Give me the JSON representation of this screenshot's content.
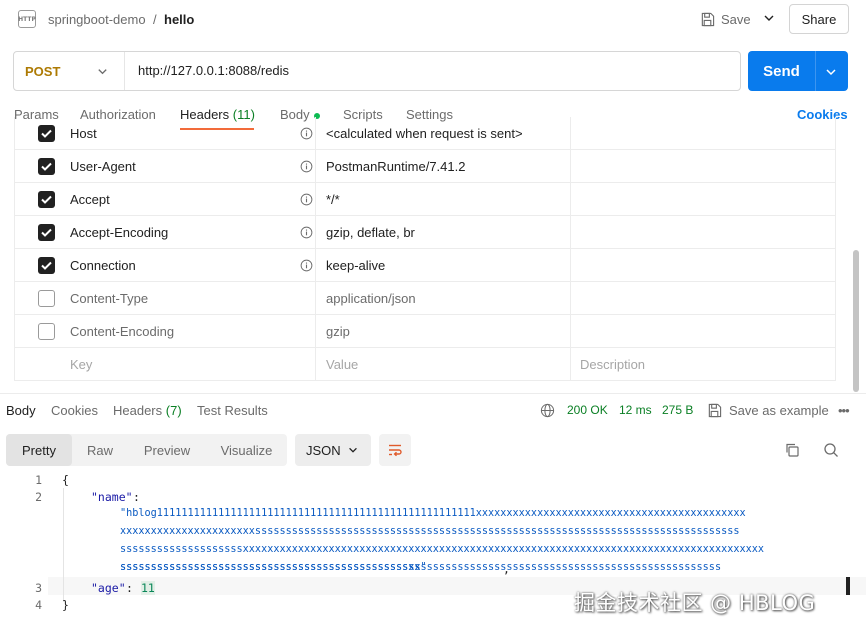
{
  "breadcrumb": {
    "collection": "springboot-demo",
    "separator": "/",
    "request": "hello"
  },
  "header": {
    "save_label": "Save",
    "share_label": "Share",
    "http_icon_text": "HTTP"
  },
  "request": {
    "method": "POST",
    "url": "http://127.0.0.1:8088/redis",
    "send_label": "Send"
  },
  "request_tabs": [
    {
      "label": "Params"
    },
    {
      "label": "Authorization"
    },
    {
      "label": "Headers",
      "count": "(11)"
    },
    {
      "label": "Body"
    },
    {
      "label": "Scripts"
    },
    {
      "label": "Settings"
    }
  ],
  "cookies_label": "Cookies",
  "headers_table": {
    "rows": [
      {
        "checked": true,
        "key": "Host",
        "value": "<calculated when request is sent>"
      },
      {
        "checked": true,
        "key": "User-Agent",
        "value": "PostmanRuntime/7.41.2"
      },
      {
        "checked": true,
        "key": "Accept",
        "value": "*/*"
      },
      {
        "checked": true,
        "key": "Accept-Encoding",
        "value": "gzip, deflate, br"
      },
      {
        "checked": true,
        "key": "Connection",
        "value": "keep-alive"
      },
      {
        "checked": false,
        "key": "Content-Type",
        "value": "application/json"
      },
      {
        "checked": false,
        "key": "Content-Encoding",
        "value": "gzip"
      }
    ],
    "placeholder": {
      "key": "Key",
      "value": "Value",
      "description": "Description"
    }
  },
  "response_tabs": [
    {
      "label": "Body"
    },
    {
      "label": "Cookies"
    },
    {
      "label": "Headers",
      "count": "(7)"
    },
    {
      "label": "Test Results"
    }
  ],
  "response_meta": {
    "status": "200 OK",
    "time": "12 ms",
    "size": "275 B",
    "save_example": "Save as example",
    "more": "•••"
  },
  "format_tabs": [
    "Pretty",
    "Raw",
    "Preview",
    "Visualize"
  ],
  "format_select": "JSON",
  "code": {
    "line_numbers": [
      "1",
      "2",
      "3",
      "4"
    ],
    "open_brace": "{",
    "close_brace": "}",
    "name_key": "\"name\"",
    "colon": ":",
    "name_value_lines": [
      "\"hblog1111111111111111111111111111111111111111111111111111xxxxxxxxxxxxxxxxxxxxxxxxxxxxxxxxxxxxxxxxxxxx",
      "xxxxxxxxxxxxxxxxxxxxxxsssssssssssssssssssssssssssssssssssssssssssssssssssssssssssssssssssssssssssssss",
      "ssssssssssssssssssssxxxxxxxxxxxxxxxxxxxxxxxxxxxxxxxxxxxxxxxxxxxxxxxxxxxxxxxxxxxxxxxxxxxxxxxxxxxxxxxxxxxxx",
      "ssssssssssssssssssssssssssssssssssssssssssssssssssssssssssssssssssssssssssssssssssssssssssssssssss",
      "sssssssssssssssssssssssssssssssssssssssssssssssxx\""
    ],
    "comma": ",",
    "age_key": "\"age\"",
    "age_value": "11"
  },
  "watermark": "掘金技术社区 @ HBLOG"
}
